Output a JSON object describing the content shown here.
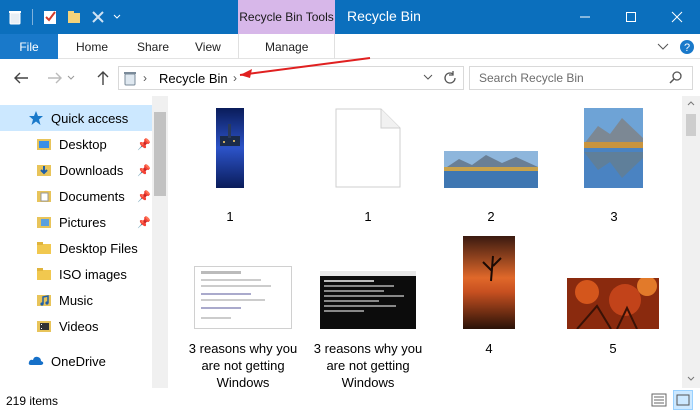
{
  "window": {
    "title": "Recycle Bin",
    "tools_tab": "Recycle Bin Tools"
  },
  "ribbon": {
    "file": "File",
    "home": "Home",
    "share": "Share",
    "view": "View",
    "manage": "Manage"
  },
  "address": {
    "path": "Recycle Bin",
    "search_placeholder": "Search Recycle Bin"
  },
  "nav": {
    "items": [
      {
        "label": "Quick access",
        "icon": "star-icon"
      },
      {
        "label": "Desktop",
        "icon": "desktop-icon"
      },
      {
        "label": "Downloads",
        "icon": "download-icon"
      },
      {
        "label": "Documents",
        "icon": "documents-icon"
      },
      {
        "label": "Pictures",
        "icon": "pictures-icon"
      },
      {
        "label": "Desktop Files",
        "icon": "folder-icon"
      },
      {
        "label": "ISO images",
        "icon": "folder-icon"
      },
      {
        "label": "Music",
        "icon": "music-icon"
      },
      {
        "label": "Videos",
        "icon": "videos-icon"
      },
      {
        "label": "OneDrive",
        "icon": "cloud-icon"
      }
    ]
  },
  "files": [
    {
      "name": "1"
    },
    {
      "name": "1"
    },
    {
      "name": "2"
    },
    {
      "name": "3"
    },
    {
      "name": "3 reasons why you are not getting Windows"
    },
    {
      "name": "3 reasons why you are not getting Windows"
    },
    {
      "name": "4"
    },
    {
      "name": "5"
    }
  ],
  "status": {
    "count": "219 items"
  },
  "colors": {
    "titlebar": "#0b6fbd",
    "tools_tab": "#d7b7e9",
    "file_tab": "#1979ca",
    "selection": "#cce8ff",
    "annotation_arrow": "#e02020"
  }
}
